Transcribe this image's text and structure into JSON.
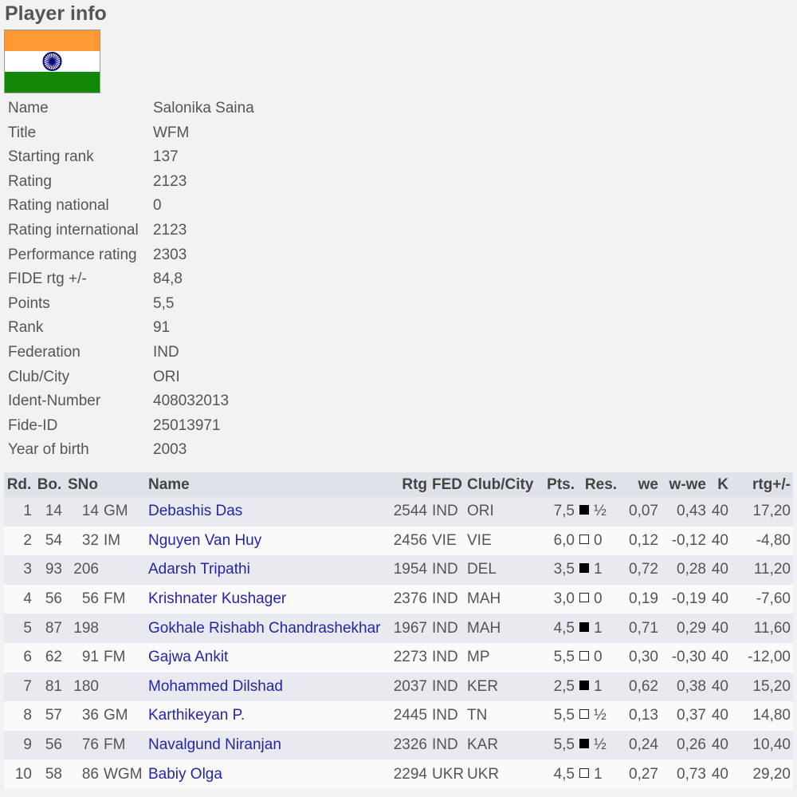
{
  "page": {
    "title": "Player info"
  },
  "flag": {
    "icon": "india-flag-icon",
    "colors": [
      "#ff9933",
      "#ffffff",
      "#138808",
      "#000080"
    ]
  },
  "player_info": [
    {
      "label": "Name",
      "value": "Salonika Saina"
    },
    {
      "label": "Title",
      "value": "WFM"
    },
    {
      "label": "Starting rank",
      "value": "137"
    },
    {
      "label": "Rating",
      "value": "2123"
    },
    {
      "label": "Rating national",
      "value": "0"
    },
    {
      "label": "Rating international",
      "value": "2123"
    },
    {
      "label": "Performance rating",
      "value": "2303"
    },
    {
      "label": "FIDE rtg +/-",
      "value": "84,8"
    },
    {
      "label": "Points",
      "value": "5,5"
    },
    {
      "label": "Rank",
      "value": "91"
    },
    {
      "label": "Federation",
      "value": "IND"
    },
    {
      "label": "Club/City",
      "value": "ORI"
    },
    {
      "label": "Ident-Number",
      "value": "408032013"
    },
    {
      "label": "Fide-ID",
      "value": "25013971"
    },
    {
      "label": "Year of birth",
      "value": "2003"
    }
  ],
  "results": {
    "headers": [
      "Rd.",
      "Bo.",
      "SNo",
      "",
      "Name",
      "Rtg",
      "FED",
      "Club/City",
      "Pts.",
      "Res.",
      "we",
      "w-we",
      "K",
      "rtg+/-"
    ],
    "rows": [
      {
        "rd": "1",
        "bo": "14",
        "sno": "14",
        "title": "GM",
        "name": "Debashis Das",
        "rtg": "2544",
        "fed": "IND",
        "club": "ORI",
        "pts": "7,5",
        "color": "black",
        "res": "½",
        "we": "0,07",
        "wwe": "0,43",
        "k": "40",
        "rtgdiff": "17,20"
      },
      {
        "rd": "2",
        "bo": "54",
        "sno": "32",
        "title": "IM",
        "name": "Nguyen Van Huy",
        "rtg": "2456",
        "fed": "VIE",
        "club": "VIE",
        "pts": "6,0",
        "color": "white",
        "res": "0",
        "we": "0,12",
        "wwe": "-0,12",
        "k": "40",
        "rtgdiff": "-4,80"
      },
      {
        "rd": "3",
        "bo": "93",
        "sno": "206",
        "title": "",
        "name": "Adarsh Tripathi",
        "rtg": "1954",
        "fed": "IND",
        "club": "DEL",
        "pts": "3,5",
        "color": "black",
        "res": "1",
        "we": "0,72",
        "wwe": "0,28",
        "k": "40",
        "rtgdiff": "11,20"
      },
      {
        "rd": "4",
        "bo": "56",
        "sno": "56",
        "title": "FM",
        "name": "Krishnater Kushager",
        "rtg": "2376",
        "fed": "IND",
        "club": "MAH",
        "pts": "3,0",
        "color": "white",
        "res": "0",
        "we": "0,19",
        "wwe": "-0,19",
        "k": "40",
        "rtgdiff": "-7,60"
      },
      {
        "rd": "5",
        "bo": "87",
        "sno": "198",
        "title": "",
        "name": "Gokhale Rishabh Chandrashekhar",
        "rtg": "1967",
        "fed": "IND",
        "club": "MAH",
        "pts": "4,5",
        "color": "black",
        "res": "1",
        "we": "0,71",
        "wwe": "0,29",
        "k": "40",
        "rtgdiff": "11,60"
      },
      {
        "rd": "6",
        "bo": "62",
        "sno": "91",
        "title": "FM",
        "name": "Gajwa Ankit",
        "rtg": "2273",
        "fed": "IND",
        "club": "MP",
        "pts": "5,5",
        "color": "white",
        "res": "0",
        "we": "0,30",
        "wwe": "-0,30",
        "k": "40",
        "rtgdiff": "-12,00"
      },
      {
        "rd": "7",
        "bo": "81",
        "sno": "180",
        "title": "",
        "name": "Mohammed Dilshad",
        "rtg": "2037",
        "fed": "IND",
        "club": "KER",
        "pts": "2,5",
        "color": "black",
        "res": "1",
        "we": "0,62",
        "wwe": "0,38",
        "k": "40",
        "rtgdiff": "15,20"
      },
      {
        "rd": "8",
        "bo": "57",
        "sno": "36",
        "title": "GM",
        "name": "Karthikeyan P.",
        "rtg": "2445",
        "fed": "IND",
        "club": "TN",
        "pts": "5,5",
        "color": "white",
        "res": "½",
        "we": "0,13",
        "wwe": "0,37",
        "k": "40",
        "rtgdiff": "14,80"
      },
      {
        "rd": "9",
        "bo": "56",
        "sno": "76",
        "title": "FM",
        "name": "Navalgund Niranjan",
        "rtg": "2326",
        "fed": "IND",
        "club": "KAR",
        "pts": "5,5",
        "color": "black",
        "res": "½",
        "we": "0,24",
        "wwe": "0,26",
        "k": "40",
        "rtgdiff": "10,40"
      },
      {
        "rd": "10",
        "bo": "58",
        "sno": "86",
        "title": "WGM",
        "name": "Babiy Olga",
        "rtg": "2294",
        "fed": "UKR",
        "club": "UKR",
        "pts": "4,5",
        "color": "white",
        "res": "1",
        "we": "0,27",
        "wwe": "0,73",
        "k": "40",
        "rtgdiff": "29,20"
      }
    ]
  }
}
